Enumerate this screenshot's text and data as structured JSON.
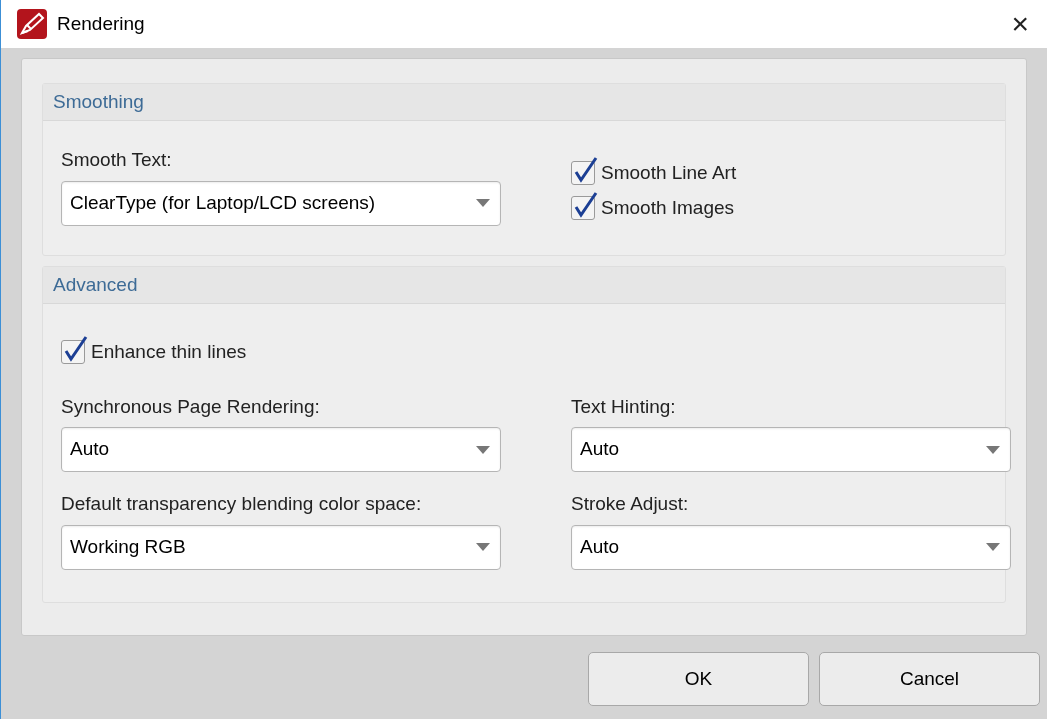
{
  "window": {
    "title": "Rendering",
    "close": "×"
  },
  "smoothing": {
    "title": "Smoothing",
    "dropdown": {
      "label": "Smooth Text:",
      "value": "ClearType (for Laptop/LCD screens)"
    },
    "checkboxes": [
      {
        "label": "Smooth Line Art",
        "checked": true
      },
      {
        "label": "Smooth Images",
        "checked": true
      }
    ]
  },
  "advanced": {
    "title": "Advanced",
    "checkboxes": [
      {
        "label": "Enhance thin lines",
        "checked": true
      }
    ],
    "dropdowns": [
      {
        "label": "Synchronous Page Rendering:",
        "value": "Auto"
      },
      {
        "label": "Text Hinting:",
        "value": "Auto"
      },
      {
        "label": "Default transparency blending color space:",
        "value": "Working RGB"
      },
      {
        "label": "Stroke Adjust:",
        "value": "Auto"
      }
    ]
  },
  "buttons": [
    "OK",
    "Cancel"
  ]
}
